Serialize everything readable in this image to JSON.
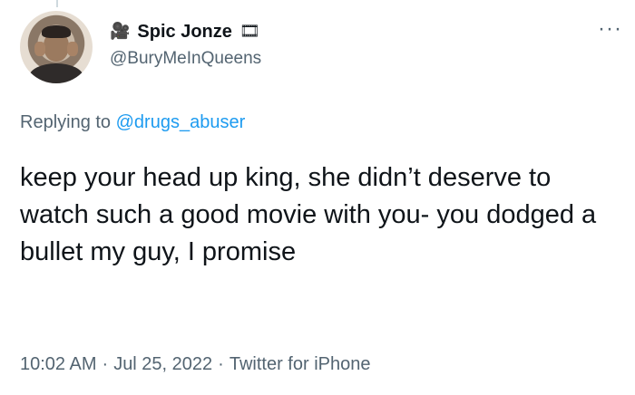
{
  "tweet": {
    "author": {
      "display_name": "Spic Jonze",
      "handle": "@BuryMeInQueens",
      "name_prefix_emoji": "🎥",
      "name_suffix_emoji": "🎞",
      "avatar_icon": "profile-photo"
    },
    "more_options": "···",
    "replying_to": {
      "prefix": "Replying to",
      "mention": "@drugs_abuser"
    },
    "text": "keep your head up king, she didn’t deserve to watch such a good movie with you- you dodged a bullet my guy, I promise",
    "meta": {
      "time": "10:02 AM",
      "separator": "·",
      "date": "Jul 25, 2022",
      "source": "Twitter for iPhone"
    }
  },
  "colors": {
    "text": "#0f1419",
    "secondary": "#536471",
    "link": "#1d9bf0",
    "background": "#ffffff"
  }
}
